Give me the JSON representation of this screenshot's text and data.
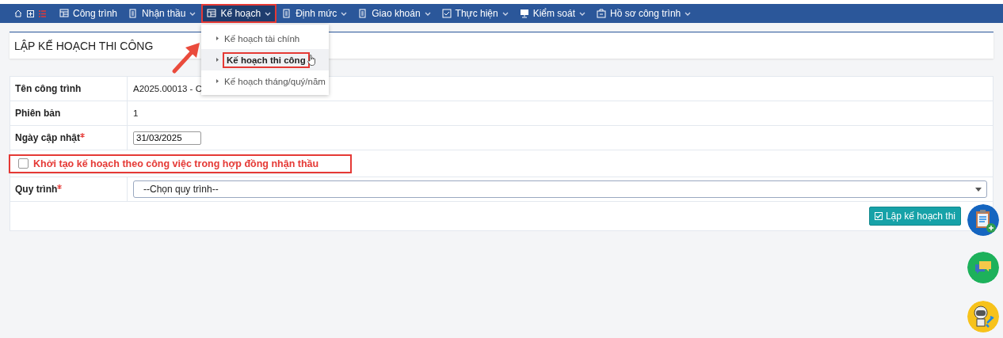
{
  "nav": {
    "items": [
      {
        "label": "Công trình",
        "dropdown": false,
        "selected": false,
        "highlighted": false
      },
      {
        "label": "Nhận thầu",
        "dropdown": true,
        "selected": false,
        "highlighted": false
      },
      {
        "label": "Kế hoạch",
        "dropdown": true,
        "selected": true,
        "highlighted": true
      },
      {
        "label": "Định mức",
        "dropdown": true,
        "selected": false,
        "highlighted": false
      },
      {
        "label": "Giao khoán",
        "dropdown": true,
        "selected": false,
        "highlighted": false
      },
      {
        "label": "Thực hiện",
        "dropdown": true,
        "selected": false,
        "highlighted": false
      },
      {
        "label": "Kiểm soát",
        "dropdown": true,
        "selected": false,
        "highlighted": false
      },
      {
        "label": "Hồ sơ công trình",
        "dropdown": true,
        "selected": false,
        "highlighted": false
      }
    ]
  },
  "menu": {
    "items": [
      {
        "label": "Kế hoạch tài chính",
        "selected": false,
        "highlighted": false
      },
      {
        "label": "Kế hoạch thi công",
        "selected": true,
        "highlighted": true
      },
      {
        "label": "Kế hoạch tháng/quý/năm",
        "selected": false,
        "highlighted": false
      }
    ]
  },
  "panel": {
    "title": "LẬP KẾ HOẠCH THI CÔNG"
  },
  "form": {
    "rows": [
      {
        "kind": "text",
        "label": "Tên công trình",
        "required": false,
        "value": "A2025.00013 - C"
      },
      {
        "kind": "text",
        "label": "Phiên bản",
        "required": false,
        "value": "1"
      },
      {
        "kind": "input",
        "label": "Ngày cập nhật",
        "required": true,
        "value": "31/03/2025"
      },
      {
        "kind": "checkbox",
        "label": "Khởi tạo kế hoạch theo công việc trong hợp đồng nhận thầu",
        "checked": false,
        "highlighted": true
      },
      {
        "kind": "select",
        "label": "Quy trình",
        "required": true,
        "value": "--Chọn quy trình--"
      }
    ],
    "submit": "Lập kế hoạch thi"
  }
}
